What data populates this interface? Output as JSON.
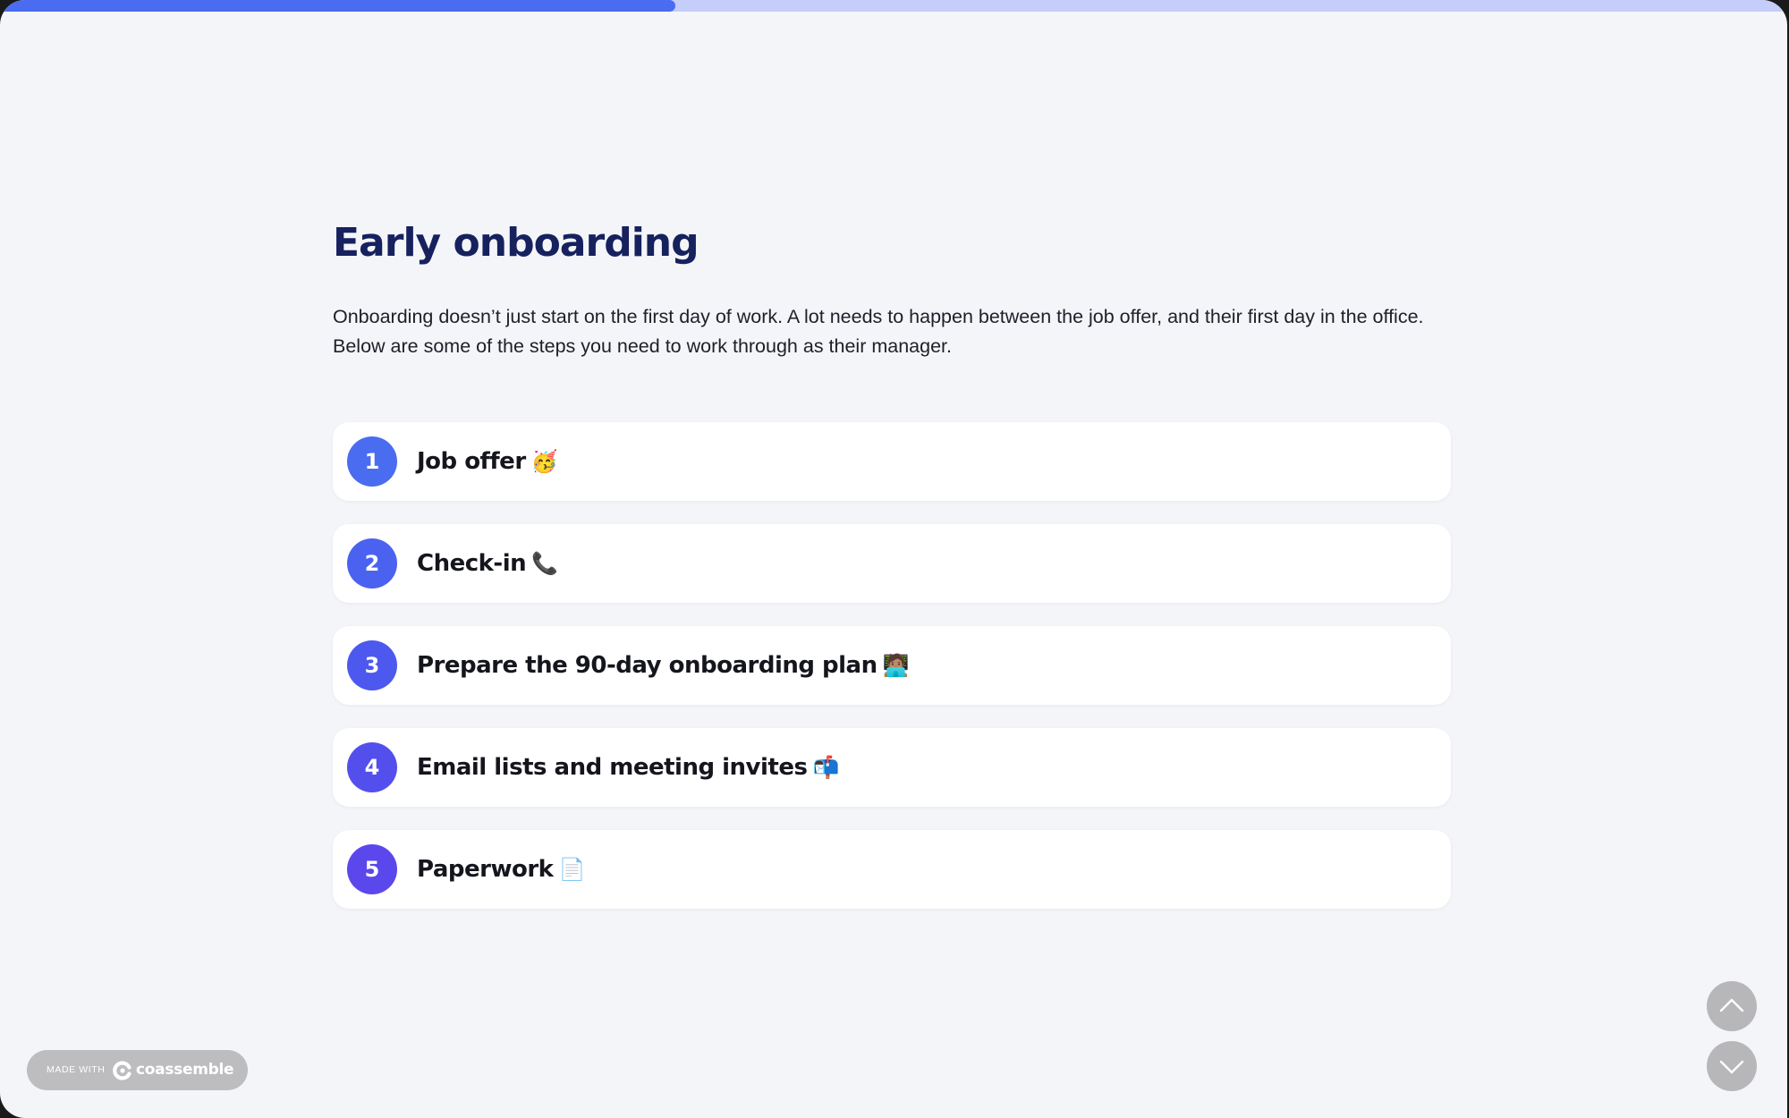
{
  "progress": {
    "fraction": 0.378
  },
  "heading": "Early onboarding",
  "intro": {
    "line1": "Onboarding doesn’t just start on the first day of work. A lot needs to happen between the job offer, and their first day in the office.",
    "line2": "Below are some of the steps you need to work through as their manager."
  },
  "steps": [
    {
      "number": "1",
      "label": "Job offer",
      "emoji": "🥳",
      "color": "#4a6cf0"
    },
    {
      "number": "2",
      "label": "Check-in",
      "emoji": "📞",
      "color": "#4a62ef"
    },
    {
      "number": "3",
      "label": "Prepare the 90-day onboarding plan",
      "emoji": "🧑🏽‍💻",
      "color": "#4d58ee"
    },
    {
      "number": "4",
      "label": "Email lists and meeting invites",
      "emoji": "📬",
      "color": "#534fed"
    },
    {
      "number": "5",
      "label": "Paperwork",
      "emoji": "📄",
      "color": "#5b48ec"
    }
  ],
  "badge": {
    "made_with": "MADE WITH",
    "brand": "coassemble"
  },
  "nav": {
    "up_icon": "chevron-up-icon",
    "down_icon": "chevron-down-icon"
  }
}
